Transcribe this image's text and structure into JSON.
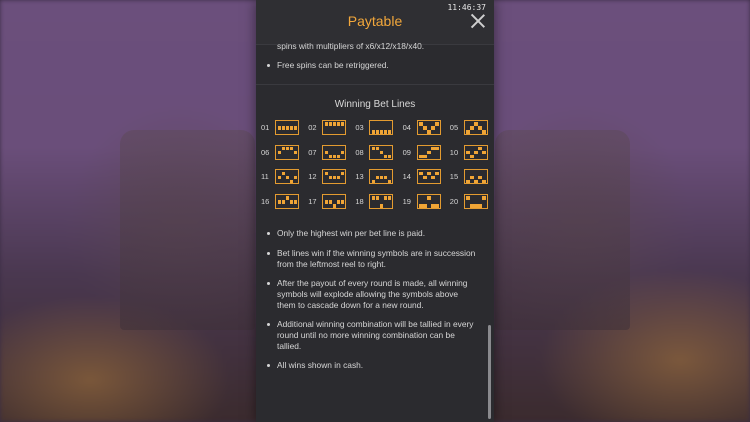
{
  "header": {
    "title": "Paytable",
    "clock": "11:46:37"
  },
  "free_spins": {
    "continued_text": "spins with multipliers of x6/x12/x18/x40.",
    "retrigger_text": "Free spins can be retriggered."
  },
  "bet_lines": {
    "title": "Winning Bet Lines",
    "lines": [
      {
        "num": "01",
        "rows": [
          1,
          1,
          1,
          1,
          1
        ]
      },
      {
        "num": "02",
        "rows": [
          0,
          0,
          0,
          0,
          0
        ]
      },
      {
        "num": "03",
        "rows": [
          2,
          2,
          2,
          2,
          2
        ]
      },
      {
        "num": "04",
        "rows": [
          0,
          1,
          2,
          1,
          0
        ]
      },
      {
        "num": "05",
        "rows": [
          2,
          1,
          0,
          1,
          2
        ]
      },
      {
        "num": "06",
        "rows": [
          1,
          0,
          0,
          0,
          1
        ]
      },
      {
        "num": "07",
        "rows": [
          1,
          2,
          2,
          2,
          1
        ]
      },
      {
        "num": "08",
        "rows": [
          0,
          0,
          1,
          2,
          2
        ]
      },
      {
        "num": "09",
        "rows": [
          2,
          2,
          1,
          0,
          0
        ]
      },
      {
        "num": "10",
        "rows": [
          1,
          2,
          1,
          0,
          1
        ]
      },
      {
        "num": "11",
        "rows": [
          1,
          0,
          1,
          2,
          1
        ]
      },
      {
        "num": "12",
        "rows": [
          0,
          1,
          1,
          1,
          0
        ]
      },
      {
        "num": "13",
        "rows": [
          2,
          1,
          1,
          1,
          2
        ]
      },
      {
        "num": "14",
        "rows": [
          0,
          1,
          0,
          1,
          0
        ]
      },
      {
        "num": "15",
        "rows": [
          2,
          1,
          2,
          1,
          2
        ]
      },
      {
        "num": "16",
        "rows": [
          1,
          1,
          0,
          1,
          1
        ]
      },
      {
        "num": "17",
        "rows": [
          1,
          1,
          2,
          1,
          1
        ]
      },
      {
        "num": "18",
        "rows": [
          0,
          0,
          2,
          0,
          0
        ]
      },
      {
        "num": "19",
        "rows": [
          2,
          2,
          0,
          2,
          2
        ]
      },
      {
        "num": "20",
        "rows": [
          0,
          2,
          2,
          2,
          0
        ]
      }
    ]
  },
  "rules": [
    "Only the highest win per bet line is paid.",
    "Bet lines win if the winning symbols are in succession from the leftmost reel to right.",
    "After the payout of every round is made, all winning symbols will explode allowing the symbols above them to cascade down for a new round.",
    "Additional winning combination will be tallied in every round until no more winning combination can be tallied.",
    "All wins shown in cash."
  ],
  "colors": {
    "accent": "#f2a73b",
    "panel": "#2b2b2f",
    "text": "#d6d6d6"
  }
}
